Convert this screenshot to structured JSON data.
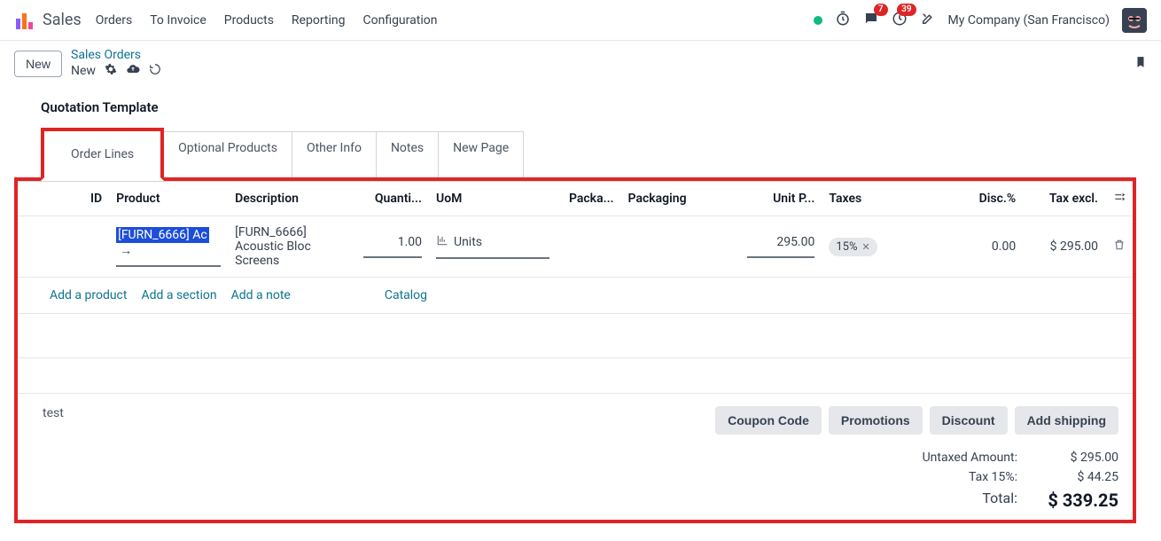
{
  "nav": {
    "app": "Sales",
    "items": [
      "Orders",
      "To Invoice",
      "Products",
      "Reporting",
      "Configuration"
    ],
    "msg_badge": "7",
    "activity_badge": "39",
    "company": "My Company (San Francisco)"
  },
  "breadcrumb": {
    "new_btn": "New",
    "parent": "Sales Orders",
    "current": "New"
  },
  "section_title": "Quotation Template",
  "tabs": [
    "Order Lines",
    "Optional Products",
    "Other Info",
    "Notes",
    "New Page"
  ],
  "columns": {
    "id": "ID",
    "product": "Product",
    "description": "Description",
    "qty": "Quanti...",
    "uom": "UoM",
    "packa": "Packa...",
    "packaging": "Packaging",
    "unitp": "Unit P...",
    "taxes": "Taxes",
    "disc": "Disc.%",
    "taxexcl": "Tax excl."
  },
  "row": {
    "product_sel": "[FURN_6666] Ac",
    "description": "[FURN_6666] Acoustic Bloc Screens",
    "qty": "1.00",
    "uom": "Units",
    "unit_price": "295.00",
    "tax_tag": "15%",
    "disc": "0.00",
    "tax_excl": "$ 295.00"
  },
  "links": {
    "add_product": "Add a product",
    "add_section": "Add a section",
    "add_note": "Add a note",
    "catalog": "Catalog"
  },
  "buttons": {
    "coupon": "Coupon Code",
    "promotions": "Promotions",
    "discount": "Discount",
    "shipping": "Add shipping"
  },
  "note": "test",
  "totals": {
    "untaxed_lbl": "Untaxed Amount:",
    "untaxed_val": "$ 295.00",
    "tax_lbl": "Tax 15%:",
    "tax_val": "$ 44.25",
    "total_lbl": "Total:",
    "total_val": "$ 339.25"
  }
}
